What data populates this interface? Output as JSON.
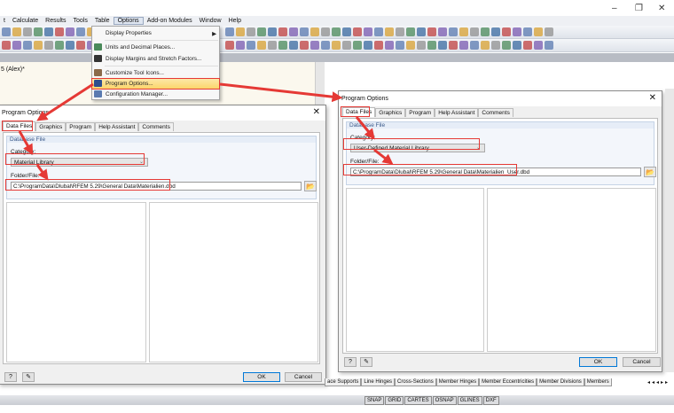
{
  "window": {
    "minimize": "–",
    "maximize": "❐",
    "close": "✕"
  },
  "menubar": {
    "items": [
      "t",
      "Calculate",
      "Results",
      "Tools",
      "Table",
      "Options",
      "Add-on Modules",
      "Window",
      "Help"
    ],
    "active": "Options"
  },
  "navigator": {
    "title": "5 (Alex)*"
  },
  "options_menu": {
    "items": [
      "Display Properties",
      "Units and Decimal Places...",
      "Display Margins and Stretch Factors...",
      "Customize Tool Icons...",
      "Program Options...",
      "Configuration Manager..."
    ],
    "highlighted": "Program Options..."
  },
  "dialog_left": {
    "title": "Program Options",
    "tabs": [
      "Data Files",
      "Graphics",
      "Program",
      "Help Assistant",
      "Comments"
    ],
    "group": "Database File",
    "category_label": "Category:",
    "category_value": "Material Library",
    "folder_label": "Folder/File:",
    "folder_value": "C:\\ProgramData\\Dlubal\\RFEM 5.29\\General Data\\Materialien.dbd",
    "ok": "OK",
    "cancel": "Cancel"
  },
  "dialog_right": {
    "title": "Program Options",
    "tabs": [
      "Data Files",
      "Graphics",
      "Program",
      "Help Assistant",
      "Comments"
    ],
    "group": "Database File",
    "category_label": "Category:",
    "category_value": "User-Defined Material Library",
    "folder_label": "Folder/File:",
    "folder_value": "C:\\ProgramData\\Dlubal\\RFEM 5.29\\General Data\\Materialien_User.dbd",
    "ok": "OK",
    "cancel": "Cancel"
  },
  "bottom_tabs": [
    "ace Supports",
    "Line Hinges",
    "Cross-Sections",
    "Member Hinges",
    "Member Eccentricities",
    "Member Divisions",
    "Members"
  ],
  "status_cells": [
    "SNAP",
    "GRID",
    "CARTES",
    "OSNAP",
    "GLINES",
    "DXF"
  ],
  "colors": {
    "highlight": "#e53935",
    "menu_hover": "#fbd56b",
    "group_title": "#3b5a8a"
  }
}
